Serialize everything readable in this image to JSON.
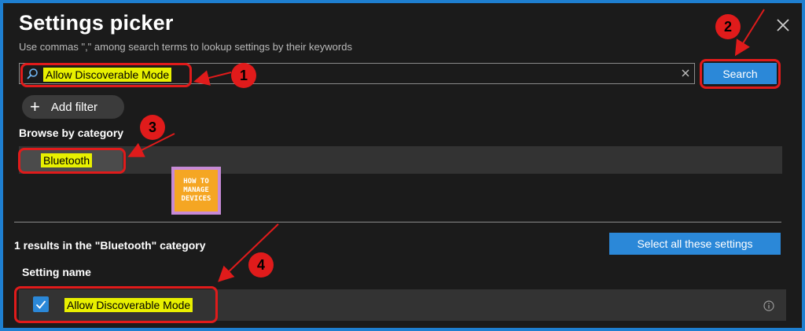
{
  "header": {
    "title": "Settings picker",
    "subtitle": "Use commas \",\" among search terms to lookup settings by their keywords",
    "close_icon": "close-icon"
  },
  "search": {
    "value": "Allow Discoverable Mode",
    "button_label": "Search",
    "search_icon": "search-icon",
    "clear_icon": "clear-icon"
  },
  "filter": {
    "add_label": "Add filter",
    "plus_glyph": "+"
  },
  "browse": {
    "heading": "Browse by category",
    "categories": [
      "Bluetooth"
    ]
  },
  "logo": {
    "line1": "HOW TO",
    "line2": "MANAGE",
    "line3": "DEVICES"
  },
  "results": {
    "summary": "1 results in the \"Bluetooth\" category",
    "select_all_label": "Select all these settings",
    "column_header": "Setting name",
    "rows": [
      {
        "label": "Allow Discoverable Mode",
        "checked": true
      }
    ]
  },
  "annotations": {
    "steps": [
      "1",
      "2",
      "3",
      "4"
    ]
  },
  "colors": {
    "accent": "#2b88d8",
    "frame": "#1e7fd0",
    "highlight_border": "#e01b1b",
    "highlight_fill": "#e8f000",
    "background": "#1b1b1b"
  }
}
